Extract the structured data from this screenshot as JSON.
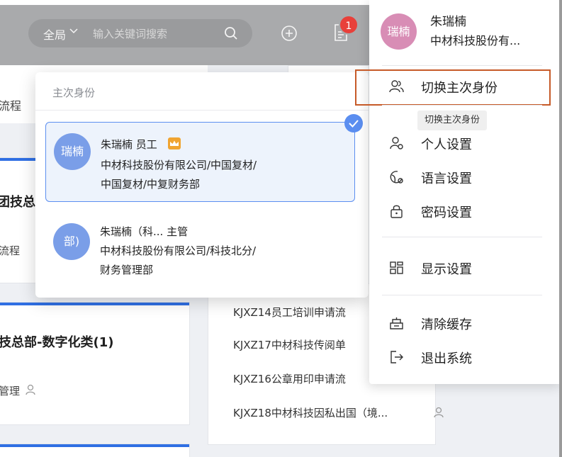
{
  "header": {
    "search_scope": "全局",
    "search_placeholder": "输入关键词搜索",
    "notification_count": "1"
  },
  "background": {
    "frag_top": "流程",
    "card1_title": "团技总",
    "card1_sub": "流程",
    "card2_title": "技总部-数字化类(1)",
    "card2_sub": "管理",
    "list_items": [
      "KJXZ14员工培训申请流",
      "KJXZ17中材科技传阅单",
      "KJXZ16公章用印申请流",
      "KJXZ18中材科技因私出国（境..."
    ]
  },
  "identity_popup": {
    "title": "主次身份",
    "identities": [
      {
        "avatar": "瑞楠",
        "name_line": "朱瑞楠 员工",
        "org_line1": "中材科技股份有限公司/中国复材/",
        "org_line2": "中国复材/中复财务部",
        "selected": true
      },
      {
        "avatar": "部)",
        "name_line": "朱瑞楠（科...    主管",
        "org_line1": "中材科技股份有限公司/科技北分/",
        "org_line2": "财务管理部",
        "selected": false
      }
    ]
  },
  "user_menu": {
    "avatar": "瑞楠",
    "name": "朱瑞楠",
    "org": "中材科技股份有...",
    "tooltip": "切换主次身份",
    "items": [
      {
        "label": "切换主次身份",
        "icon": "users-icon"
      },
      {
        "label": "个人设置",
        "icon": "user-settings-icon"
      },
      {
        "label": "语言设置",
        "icon": "language-icon"
      },
      {
        "label": "密码设置",
        "icon": "lock-icon"
      },
      {
        "label": "显示设置",
        "icon": "display-icon"
      },
      {
        "label": "清除缓存",
        "icon": "clear-cache-icon"
      },
      {
        "label": "退出系统",
        "icon": "logout-icon"
      }
    ]
  },
  "colors": {
    "accent_blue": "#5b8ef0",
    "highlight_orange": "#c65a28",
    "badge_red": "#e8403a",
    "crown_orange": "#f0a431"
  }
}
